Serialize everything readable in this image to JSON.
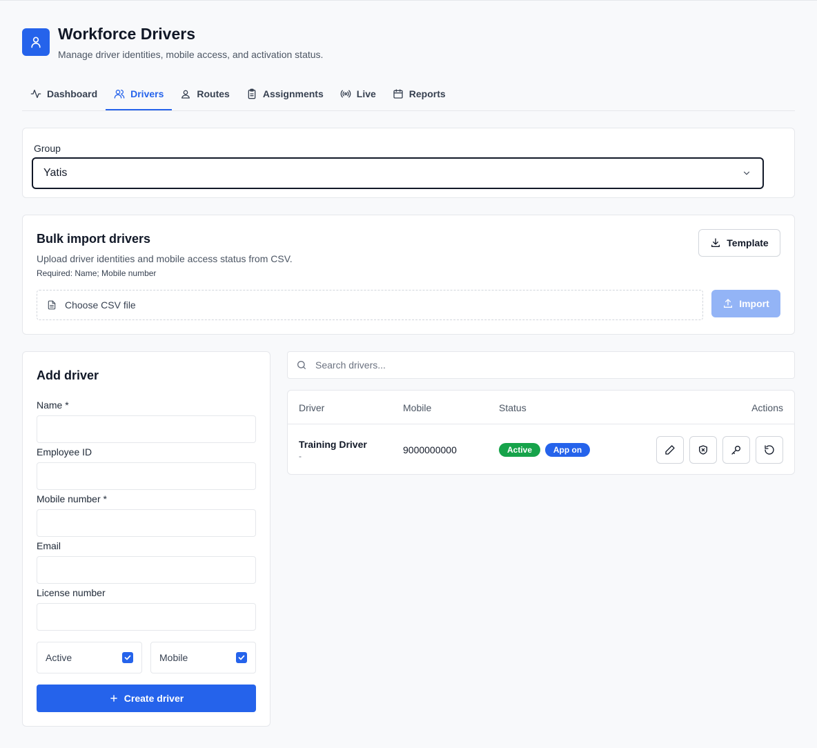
{
  "header": {
    "title": "Workforce Drivers",
    "subtitle": "Manage driver identities, mobile access, and activation status.",
    "app_icon": "user-icon",
    "accent_color": "#2563eb"
  },
  "tabs": [
    {
      "label": "Dashboard",
      "icon": "activity-icon",
      "active": false
    },
    {
      "label": "Drivers",
      "icon": "users-icon",
      "active": true
    },
    {
      "label": "Routes",
      "icon": "user-pin-icon",
      "active": false
    },
    {
      "label": "Assignments",
      "icon": "clipboard-icon",
      "active": false
    },
    {
      "label": "Live",
      "icon": "broadcast-icon",
      "active": false
    },
    {
      "label": "Reports",
      "icon": "calendar-icon",
      "active": false
    }
  ],
  "group": {
    "label": "Group",
    "selected": "Yatis"
  },
  "bulk_import": {
    "title": "Bulk import drivers",
    "description": "Upload driver identities and mobile access status from CSV.",
    "required": "Required: Name; Mobile number",
    "template_label": "Template",
    "file_placeholder": "Choose CSV file",
    "import_label": "Import"
  },
  "add_driver": {
    "title": "Add driver",
    "fields": [
      {
        "label": "Name *",
        "value": ""
      },
      {
        "label": "Employee ID",
        "value": ""
      },
      {
        "label": "Mobile number *",
        "value": ""
      },
      {
        "label": "Email",
        "value": ""
      },
      {
        "label": "License number",
        "value": ""
      }
    ],
    "active_label": "Active",
    "active_checked": true,
    "mobile_label": "Mobile",
    "mobile_checked": true,
    "create_label": "Create driver"
  },
  "search": {
    "placeholder": "Search drivers...",
    "value": ""
  },
  "table": {
    "columns": [
      "Driver",
      "Mobile",
      "Status",
      "Actions"
    ],
    "rows": [
      {
        "name": "Training Driver",
        "sub": "-",
        "mobile": "9000000000",
        "status_badge": "Active",
        "status_color": "#16a34a",
        "app_badge": "App on",
        "app_color": "#2563eb",
        "actions": [
          "pencil-icon",
          "shield-icon",
          "key-icon",
          "reset-icon"
        ]
      }
    ]
  }
}
